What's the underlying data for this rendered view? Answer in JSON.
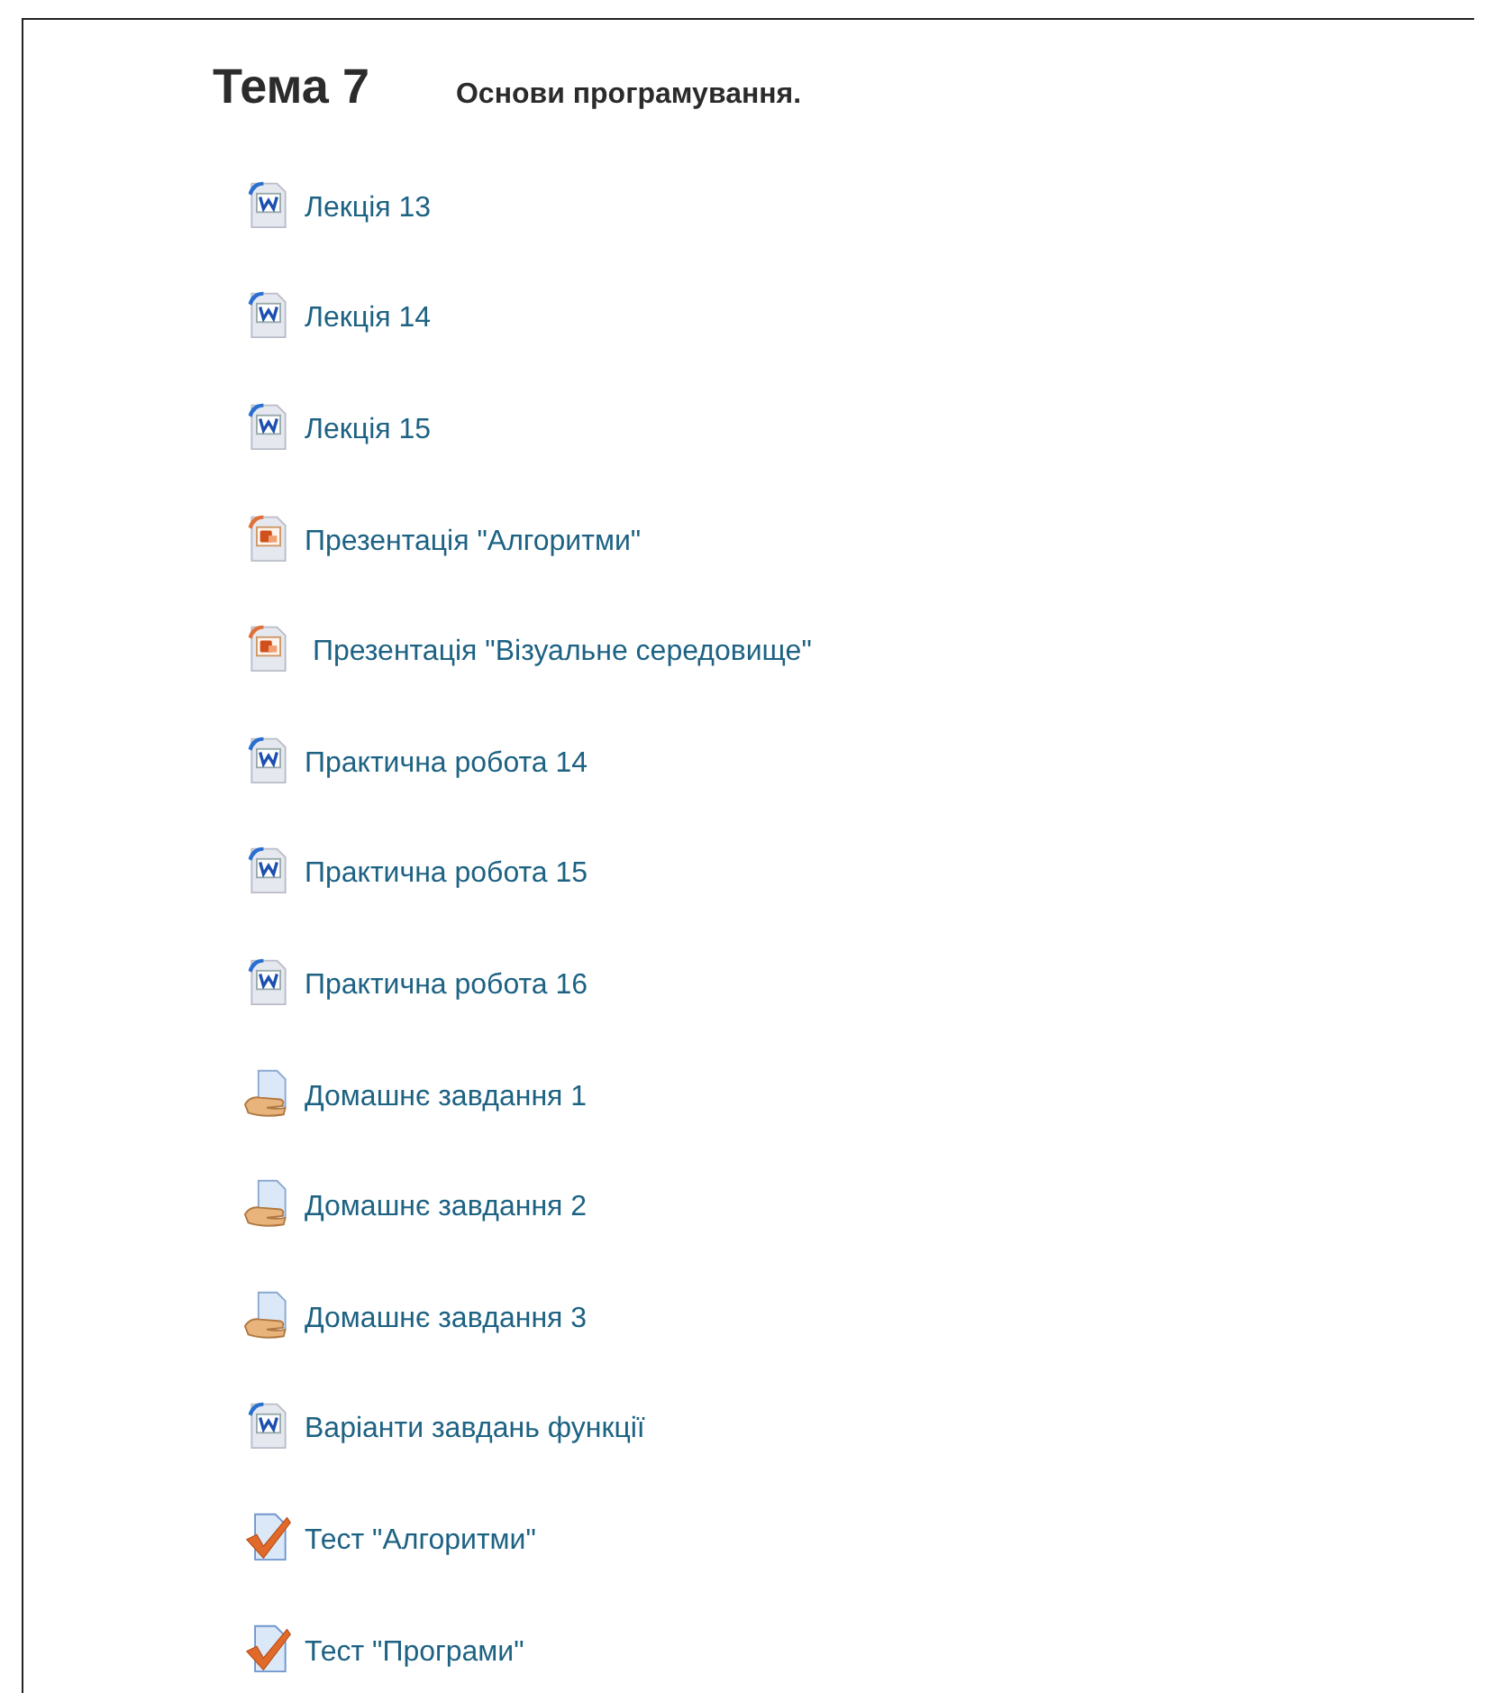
{
  "section": {
    "title": "Тема 7",
    "summary": "Основи програмування."
  },
  "items": [
    {
      "kind": "word",
      "label": "Лекція 13"
    },
    {
      "kind": "word",
      "label": "Лекція 14"
    },
    {
      "kind": "word",
      "label": "Лекція 15"
    },
    {
      "kind": "powerpoint",
      "label": "Презентація \"Алгоритми\""
    },
    {
      "kind": "powerpoint",
      "label": " Презентація \"Візуальне середовище\""
    },
    {
      "kind": "word",
      "label": "Практична робота 14"
    },
    {
      "kind": "word",
      "label": "Практична робота 15"
    },
    {
      "kind": "word",
      "label": "Практична робота 16"
    },
    {
      "kind": "assignment",
      "label": "Домашнє завдання 1"
    },
    {
      "kind": "assignment",
      "label": "Домашнє завдання 2"
    },
    {
      "kind": "assignment",
      "label": "Домашнє завдання 3"
    },
    {
      "kind": "word",
      "label": "Варіанти завдань функції"
    },
    {
      "kind": "quiz",
      "label": "Тест \"Алгоритми\""
    },
    {
      "kind": "quiz",
      "label": "Тест \"Програми\""
    }
  ]
}
